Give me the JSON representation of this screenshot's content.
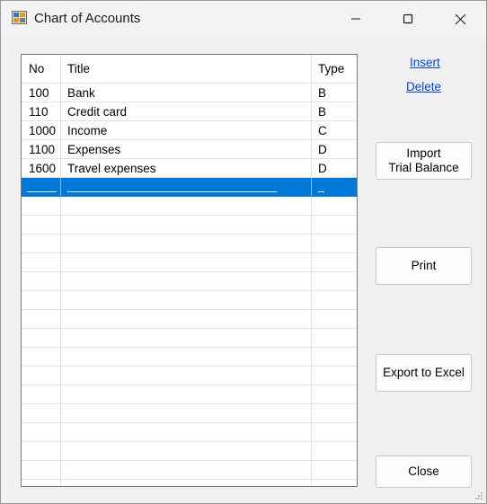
{
  "window": {
    "title": "Chart of Accounts",
    "icons": {
      "app": "ledger-app-icon",
      "minimize": "minimize-icon",
      "maximize": "maximize-icon",
      "close": "close-icon"
    }
  },
  "grid": {
    "columns": [
      "No",
      "Title",
      "Type"
    ],
    "rows": [
      {
        "no": "100",
        "title": "Bank",
        "type": "B"
      },
      {
        "no": "110",
        "title": "Credit card",
        "type": "B"
      },
      {
        "no": "1000",
        "title": "Income",
        "type": "C"
      },
      {
        "no": "1100",
        "title": "Expenses",
        "type": "D"
      },
      {
        "no": "1600",
        "title": "Travel expenses",
        "type": "D"
      }
    ],
    "selected_color": "#0078d7"
  },
  "actions": {
    "insert_label": "Insert",
    "delete_label": "Delete",
    "import_line1": "Import",
    "import_line2": "Trial Balance",
    "print_label": "Print",
    "export_label": "Export to Excel",
    "close_label": "Close"
  }
}
